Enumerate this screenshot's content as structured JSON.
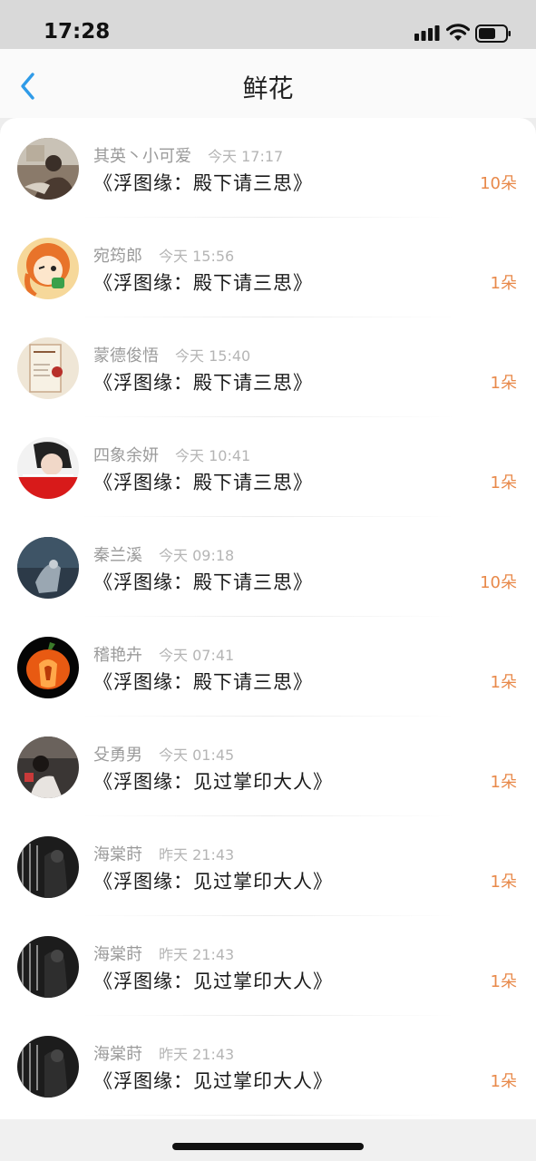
{
  "status_bar": {
    "time": "17:28"
  },
  "nav": {
    "title": "鲜花"
  },
  "rows": [
    {
      "name": "其英丶小可爱",
      "time": "今天 17:17",
      "book": "《浮图缘：殿下请三思》",
      "count": "10朵"
    },
    {
      "name": "宛筠郎",
      "time": "今天 15:56",
      "book": "《浮图缘：殿下请三思》",
      "count": "1朵"
    },
    {
      "name": "蒙德俊悟",
      "time": "今天 15:40",
      "book": "《浮图缘：殿下请三思》",
      "count": "1朵"
    },
    {
      "name": "四象余妍",
      "time": "今天 10:41",
      "book": "《浮图缘：殿下请三思》",
      "count": "1朵"
    },
    {
      "name": "秦兰溪",
      "time": "今天 09:18",
      "book": "《浮图缘：殿下请三思》",
      "count": "10朵"
    },
    {
      "name": "稽艳卉",
      "time": "今天 07:41",
      "book": "《浮图缘：殿下请三思》",
      "count": "1朵"
    },
    {
      "name": "殳勇男",
      "time": "今天 01:45",
      "book": "《浮图缘：见过掌印大人》",
      "count": "1朵"
    },
    {
      "name": "海棠莳",
      "time": "昨天 21:43",
      "book": "《浮图缘：见过掌印大人》",
      "count": "1朵"
    },
    {
      "name": "海棠莳",
      "time": "昨天 21:43",
      "book": "《浮图缘：见过掌印大人》",
      "count": "1朵"
    },
    {
      "name": "海棠莳",
      "time": "昨天 21:43",
      "book": "《浮图缘：见过掌印大人》",
      "count": "1朵"
    }
  ],
  "colors": {
    "accent": "#e8894a",
    "back": "#2f9be8"
  }
}
